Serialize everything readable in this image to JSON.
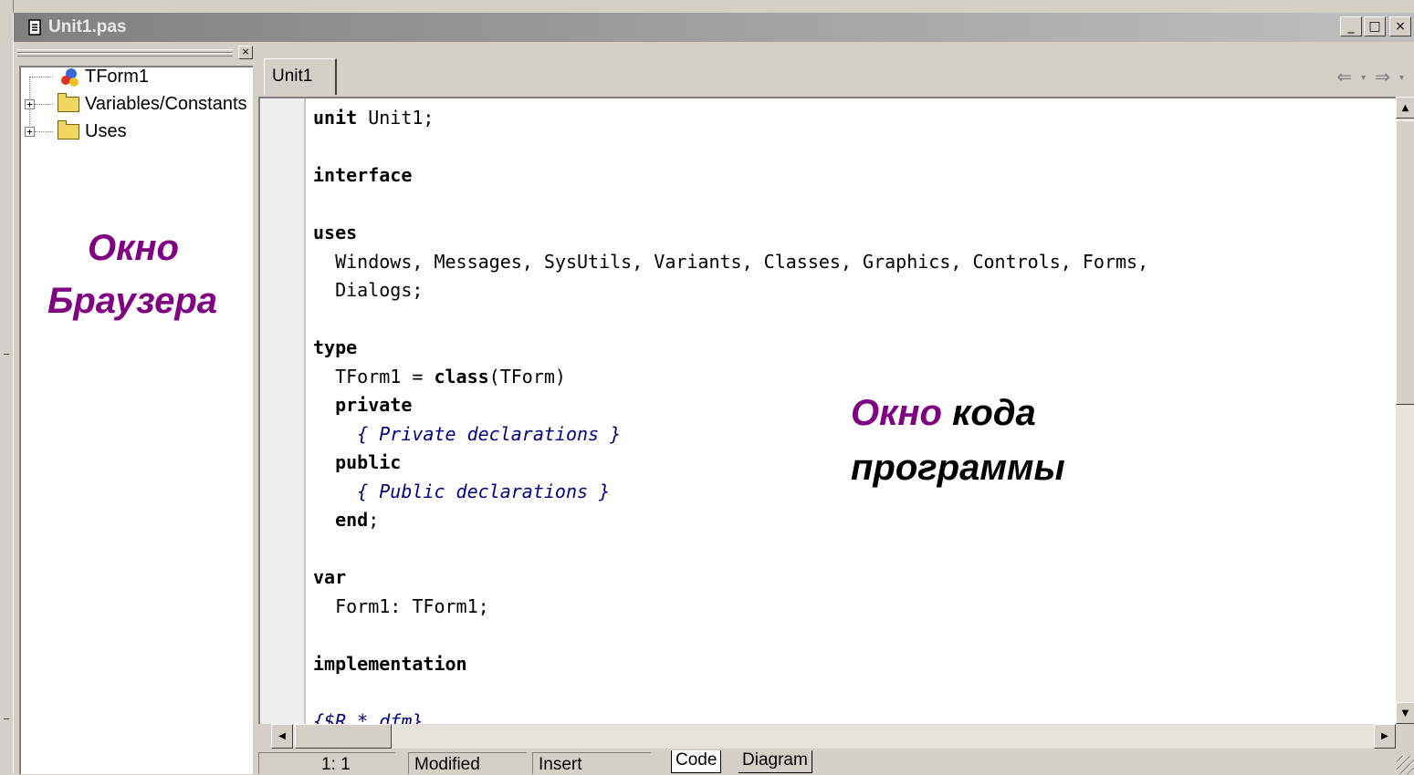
{
  "window": {
    "title": "Unit1.pas",
    "buttons": {
      "minimize": "_",
      "maximize": "□",
      "close": "×"
    }
  },
  "explorer": {
    "close_label": "×",
    "items": [
      {
        "label": "TForm1",
        "icon": "form-class-icon"
      },
      {
        "label": "Variables/Constants",
        "icon": "folder-icon",
        "expander": "+"
      },
      {
        "label": "Uses",
        "icon": "folder-icon",
        "expander": "+"
      }
    ]
  },
  "annotations": {
    "browser": [
      "Окно",
      "Браузера"
    ],
    "code_window": {
      "word1": "Окно",
      "word2": "кода",
      "line2": "программы"
    }
  },
  "editor": {
    "tab_label": "Unit1",
    "nav": {
      "back": "⇐",
      "forward": "⇒",
      "dropdown": "▾"
    },
    "code_lines": [
      [
        {
          "t": "unit",
          "k": "kw"
        },
        {
          "t": " Unit1;"
        }
      ],
      [],
      [
        {
          "t": "interface",
          "k": "kw"
        }
      ],
      [],
      [
        {
          "t": "uses",
          "k": "kw"
        }
      ],
      [
        {
          "t": "  Windows, Messages, SysUtils, Variants, Classes, Graphics, Controls, Forms,"
        }
      ],
      [
        {
          "t": "  Dialogs;"
        }
      ],
      [],
      [
        {
          "t": "type",
          "k": "kw"
        }
      ],
      [
        {
          "t": "  TForm1 = "
        },
        {
          "t": "class",
          "k": "kw"
        },
        {
          "t": "(TForm)"
        }
      ],
      [
        {
          "t": "  "
        },
        {
          "t": "private",
          "k": "kw"
        }
      ],
      [
        {
          "t": "    "
        },
        {
          "t": "{ Private declarations }",
          "k": "cm"
        }
      ],
      [
        {
          "t": "  "
        },
        {
          "t": "public",
          "k": "kw"
        }
      ],
      [
        {
          "t": "    "
        },
        {
          "t": "{ Public declarations }",
          "k": "cm"
        }
      ],
      [
        {
          "t": "  "
        },
        {
          "t": "end",
          "k": "kw"
        },
        {
          "t": ";"
        }
      ],
      [],
      [
        {
          "t": "var",
          "k": "kw"
        }
      ],
      [
        {
          "t": "  Form1: TForm1;"
        }
      ],
      [],
      [
        {
          "t": "implementation",
          "k": "kw"
        }
      ],
      [],
      [
        {
          "t": "{$R *.dfm}",
          "k": "cm"
        }
      ]
    ]
  },
  "scrollbars": {
    "up": "▲",
    "down": "▼",
    "left": "◀",
    "right": "▶"
  },
  "statusbar": {
    "position": "1:  1",
    "modified": "Modified",
    "mode": "Insert",
    "tabs": [
      "Code",
      "Diagram"
    ]
  }
}
